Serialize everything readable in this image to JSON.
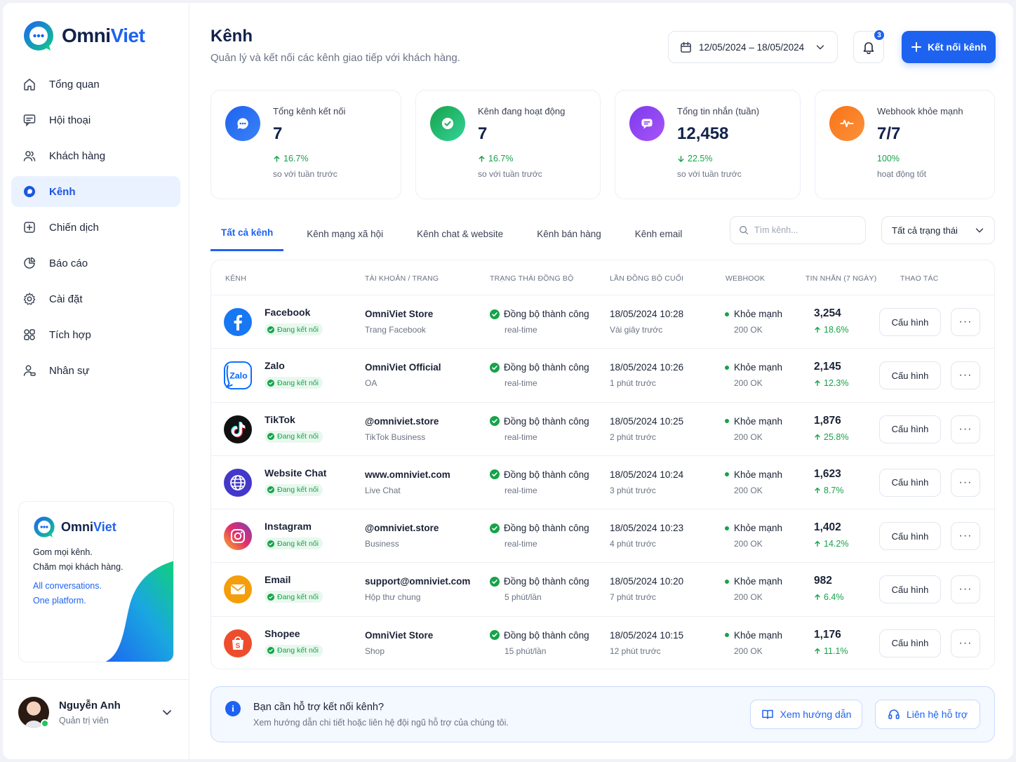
{
  "brand": {
    "part1": "Omni",
    "part2": "Viet"
  },
  "nav": [
    {
      "label": "Tổng quan",
      "icon": "home-icon",
      "active": false
    },
    {
      "label": "Hội thoại",
      "icon": "chat-icon",
      "active": false
    },
    {
      "label": "Khách hàng",
      "icon": "users-icon",
      "active": false
    },
    {
      "label": "Kênh",
      "icon": "channel-icon",
      "active": true
    },
    {
      "label": "Chiến dịch",
      "icon": "campaign-icon",
      "active": false
    },
    {
      "label": "Báo cáo",
      "icon": "pie-chart-icon",
      "active": false
    },
    {
      "label": "Cài đặt",
      "icon": "gear-icon",
      "active": false
    },
    {
      "label": "Tích hợp",
      "icon": "integration-icon",
      "active": false
    },
    {
      "label": "Nhân sự",
      "icon": "staff-icon",
      "active": false
    }
  ],
  "promo": {
    "brand1": "Omni",
    "brand2": "Viet",
    "line1": "Gom mọi kênh.",
    "line2": "Chăm mọi khách hàng.",
    "line3": "All conversations.",
    "line4": "One platform."
  },
  "user": {
    "name": "Nguyễn Anh",
    "role": "Quản trị viên"
  },
  "header": {
    "title": "Kênh",
    "subtitle": "Quản lý và kết nối các kênh giao tiếp với khách hàng.",
    "date_range": "12/05/2024 – 18/05/2024",
    "notif_count": "3",
    "connect_label": "Kết nối kênh"
  },
  "stats": [
    {
      "label": "Tổng kênh kết nối",
      "value": "7",
      "change": "16.7%",
      "direction": "up",
      "compare": "so với tuần trước",
      "color": "#1d63f0",
      "icon": "chat-bubble-icon"
    },
    {
      "label": "Kênh đang hoạt động",
      "value": "7",
      "change": "16.7%",
      "direction": "up",
      "compare": "so với tuần trước",
      "color": "#22b55c",
      "icon": "check-icon"
    },
    {
      "label": "Tổng tin nhắn (tuần)",
      "value": "12,458",
      "change": "22.5%",
      "direction": "down",
      "compare": "so với tuần trước",
      "color": "#8b3df0",
      "icon": "message-icon"
    },
    {
      "label": "Webhook khỏe mạnh",
      "value": "7/7",
      "change": "100%",
      "direction": "none",
      "compare": "hoạt động tốt",
      "color": "#f97316",
      "icon": "pulse-icon"
    }
  ],
  "tabs": [
    "Tất cả kênh",
    "Kênh mạng xã hội",
    "Kênh chat & website",
    "Kênh bán hàng",
    "Kênh email"
  ],
  "search_placeholder": "Tìm kênh...",
  "status_filter": "Tất cả trạng thái",
  "columns": [
    "KÊNH",
    "TÀI KHOẢN / TRANG",
    "TRẠNG THÁI ĐỒNG BỘ",
    "LẦN ĐỒNG BỘ CUỐI",
    "WEBHOOK",
    "TIN NHẮN (7 NGÀY)",
    "THAO TÁC"
  ],
  "channels": [
    {
      "name": "Facebook",
      "status": "Đang kết nối",
      "account": "OmniViet Store",
      "account_type": "Trang Facebook",
      "sync": "Đồng bộ thành công",
      "sync_mode": "real-time",
      "last_sync": "18/05/2024  10:28",
      "last_ago": "Vài giây trước",
      "webhook": "Khỏe mạnh",
      "webhook_code": "200 OK",
      "messages": "3,254",
      "msg_change": "18.6%",
      "icon": "facebook-icon",
      "color": "#1877f2"
    },
    {
      "name": "Zalo",
      "status": "Đang kết nối",
      "account": "OmniViet Official",
      "account_type": "OA",
      "sync": "Đồng bộ thành công",
      "sync_mode": "real-time",
      "last_sync": "18/05/2024  10:26",
      "last_ago": "1 phút trước",
      "webhook": "Khỏe mạnh",
      "webhook_code": "200 OK",
      "messages": "2,145",
      "msg_change": "12.3%",
      "icon": "zalo-icon",
      "color": "#0068ff"
    },
    {
      "name": "TikTok",
      "status": "Đang kết nối",
      "account": "@omniviet.store",
      "account_type": "TikTok Business",
      "sync": "Đồng bộ thành công",
      "sync_mode": "real-time",
      "last_sync": "18/05/2024  10:25",
      "last_ago": "2 phút trước",
      "webhook": "Khỏe mạnh",
      "webhook_code": "200 OK",
      "messages": "1,876",
      "msg_change": "25.8%",
      "icon": "tiktok-icon",
      "color": "#111111"
    },
    {
      "name": "Website Chat",
      "status": "Đang kết nối",
      "account": "www.omniviet.com",
      "account_type": "Live Chat",
      "sync": "Đồng bộ thành công",
      "sync_mode": "real-time",
      "last_sync": "18/05/2024  10:24",
      "last_ago": "3 phút trước",
      "webhook": "Khỏe mạnh",
      "webhook_code": "200 OK",
      "messages": "1,623",
      "msg_change": "8.7%",
      "icon": "globe-icon",
      "color": "#4338ca"
    },
    {
      "name": "Instagram",
      "status": "Đang kết nối",
      "account": "@omniviet.store",
      "account_type": "Business",
      "sync": "Đồng bộ thành công",
      "sync_mode": "real-time",
      "last_sync": "18/05/2024  10:23",
      "last_ago": "4 phút trước",
      "webhook": "Khỏe mạnh",
      "webhook_code": "200 OK",
      "messages": "1,402",
      "msg_change": "14.2%",
      "icon": "instagram-icon",
      "color": "#e1306c"
    },
    {
      "name": "Email",
      "status": "Đang kết nối",
      "account": "support@omniviet.com",
      "account_type": "Hộp thư chung",
      "sync": "Đồng bộ thành công",
      "sync_mode": "5 phút/lần",
      "last_sync": "18/05/2024  10:20",
      "last_ago": "7 phút trước",
      "webhook": "Khỏe mạnh",
      "webhook_code": "200 OK",
      "messages": "982",
      "msg_change": "6.4%",
      "icon": "mail-icon",
      "color": "#f59e0b"
    },
    {
      "name": "Shopee",
      "status": "Đang kết nối",
      "account": "OmniViet Store",
      "account_type": "Shop",
      "sync": "Đồng bộ thành công",
      "sync_mode": "15 phút/lần",
      "last_sync": "18/05/2024  10:15",
      "last_ago": "12 phút trước",
      "webhook": "Khỏe mạnh",
      "webhook_code": "200 OK",
      "messages": "1,176",
      "msg_change": "11.1%",
      "icon": "shopee-icon",
      "color": "#ee4d2d"
    }
  ],
  "row_actions": {
    "configure": "Cấu hình",
    "more": "···"
  },
  "help": {
    "title": "Bạn cần hỗ trợ kết nối kênh?",
    "subtitle": "Xem hướng dẫn chi tiết hoặc liên hệ đội ngũ hỗ trợ của chúng tôi.",
    "guide_label": "Xem hướng dẫn",
    "support_label": "Liên hệ hỗ trợ"
  }
}
